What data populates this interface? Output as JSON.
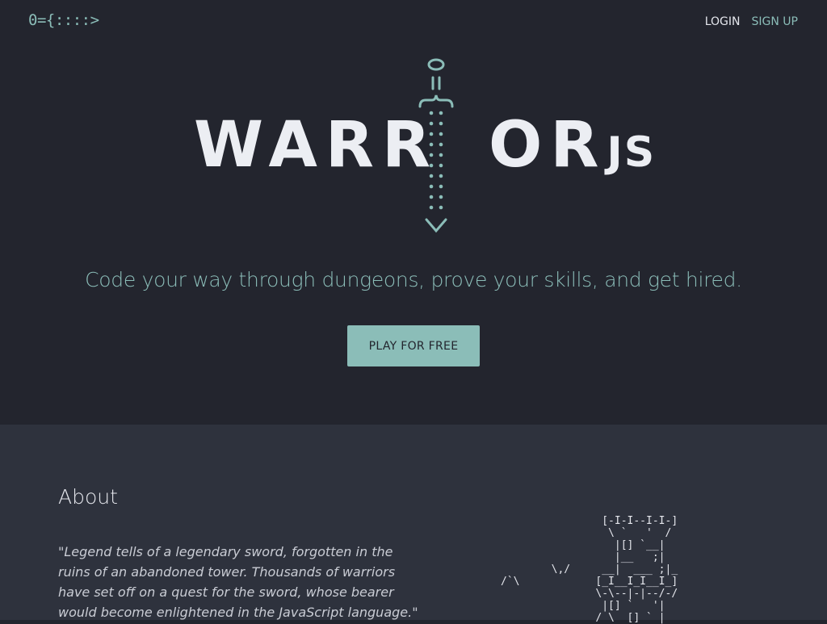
{
  "header": {
    "logo_text": "0={::::>",
    "login_label": "LOGIN",
    "signup_label": "SIGN UP"
  },
  "hero": {
    "wordmark_left": "WARR",
    "wordmark_right": "OR",
    "wordmark_suffix": "JS",
    "tagline": "Code your way through dungeons, prove your skills, and get hired.",
    "cta_label": "PLAY FOR FREE"
  },
  "about": {
    "title": "About",
    "quote": "\"Legend tells of a legendary sword, forgotten in the ruins of an abandoned tower. Thousands of warriors have set off on a quest for the sword, whose bearer would become enlightened in the JavaScript language.\"",
    "ascii_art": "                [-I-I--I-I-]\n                 \\ `   '  /\n                  |[] `__|\n                  |__   ;|\n        \\,/     __|  ___ ;|_\n/`\\            [_I__I_I__I_]\n               \\-\\--|-|--/-/\n                |[] `   '|\n               / \\  [] ` |"
  },
  "colors": {
    "accent": "#8bbdb8",
    "hero_bg": "#23252e",
    "about_bg": "#2e323d",
    "text_light": "#eceef3"
  }
}
